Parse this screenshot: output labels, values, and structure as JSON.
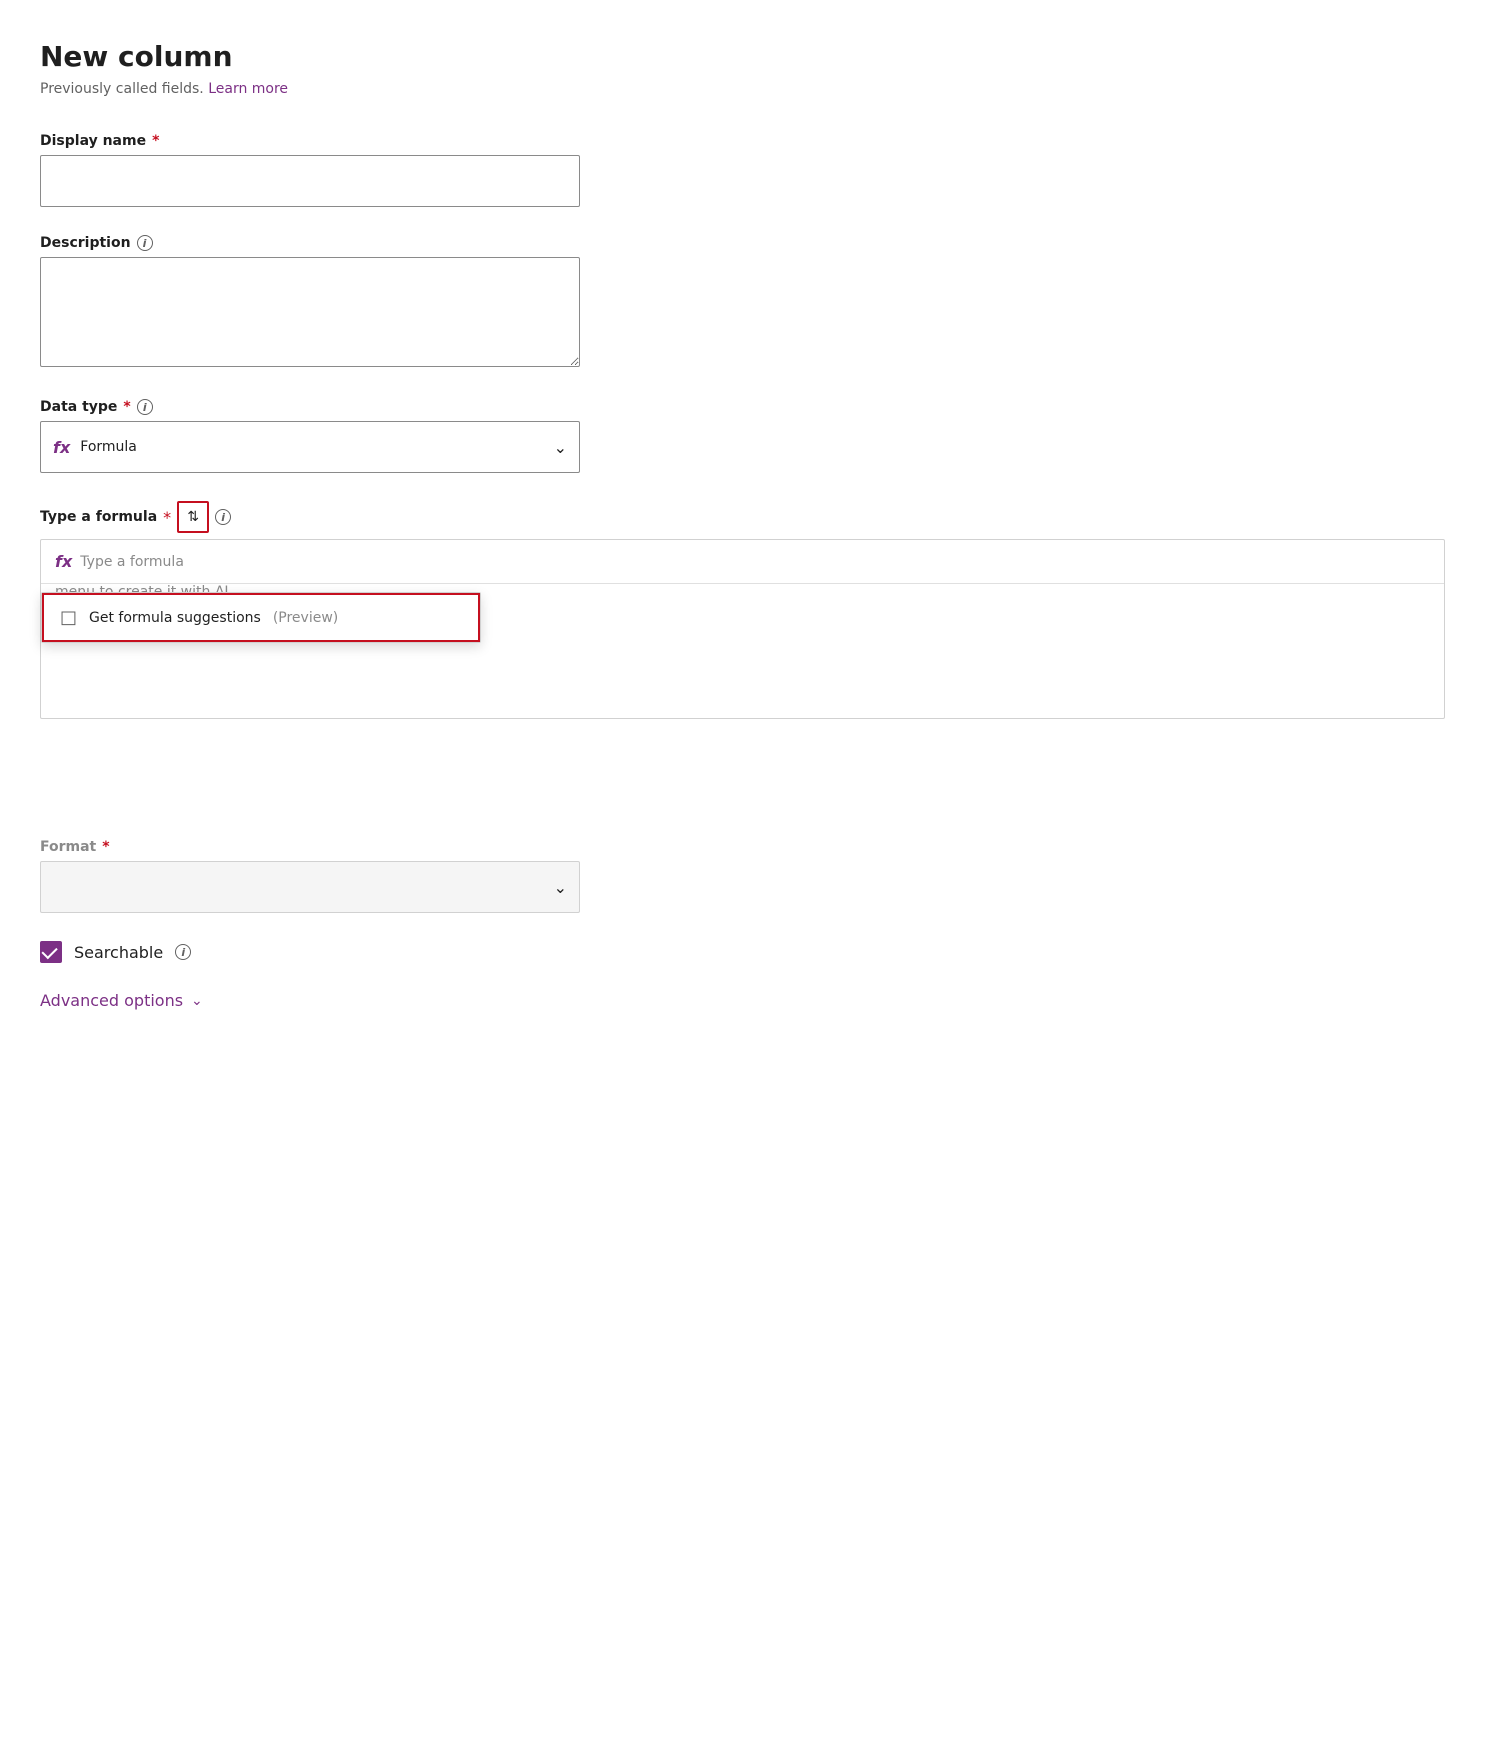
{
  "page": {
    "title": "New column",
    "subtitle": "Previously called fields.",
    "learn_more_link": "Learn more"
  },
  "display_name_field": {
    "label": "Display name",
    "required": true,
    "placeholder": ""
  },
  "description_field": {
    "label": "Description",
    "required": false,
    "info_icon": "i",
    "placeholder": ""
  },
  "data_type_field": {
    "label": "Data type",
    "required": true,
    "info_icon": "i",
    "selected_value": "Formula",
    "fx_symbol": "fx"
  },
  "formula_field": {
    "label": "Type a formula",
    "required": true,
    "info_icon": "i",
    "expand_icon": "⇅",
    "placeholder": "Type a formula",
    "suggestion_text": "menu to create it with AI.",
    "suggestion_item_label": "Get formula suggestions",
    "suggestion_preview": "(Preview)"
  },
  "format_field": {
    "label": "Format",
    "required": true
  },
  "searchable": {
    "label": "Searchable",
    "info_icon": "i",
    "checked": true
  },
  "advanced_options": {
    "label": "Advanced options"
  }
}
